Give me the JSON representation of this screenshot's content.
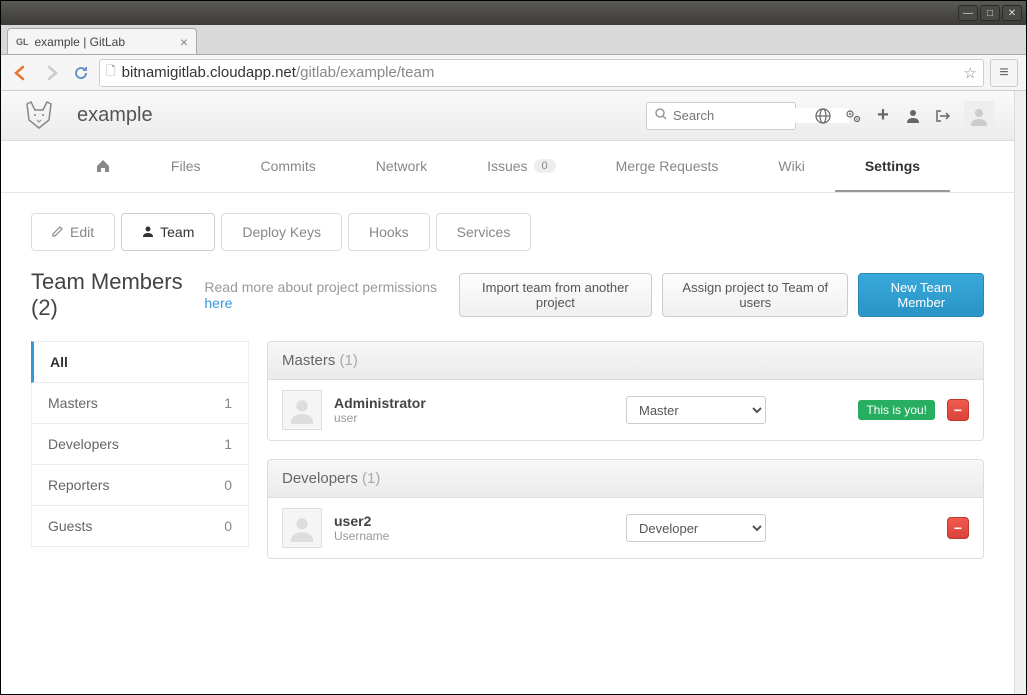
{
  "os": {
    "minimize": "—",
    "maximize": "□",
    "close": "✕"
  },
  "browser": {
    "tab_favicon": "GL",
    "tab_title": "example | GitLab",
    "url_host": "bitnamigitlab.cloudapp.net",
    "url_path": "/gitlab/example/team"
  },
  "header": {
    "project_name": "example",
    "search_placeholder": "Search"
  },
  "main_nav": {
    "home": "",
    "files": "Files",
    "commits": "Commits",
    "network": "Network",
    "issues": "Issues",
    "issues_count": "0",
    "merge_requests": "Merge Requests",
    "wiki": "Wiki",
    "settings": "Settings"
  },
  "sub_tabs": {
    "edit": "Edit",
    "team": "Team",
    "deploy_keys": "Deploy Keys",
    "hooks": "Hooks",
    "services": "Services"
  },
  "title": {
    "text": "Team Members",
    "count": "(2)",
    "perm_text": "Read more about project permissions ",
    "perm_link": "here"
  },
  "buttons": {
    "import": "Import team from another project",
    "assign": "Assign project to Team of users",
    "new_member": "New Team Member"
  },
  "filter": [
    {
      "label": "All",
      "count": ""
    },
    {
      "label": "Masters",
      "count": "1"
    },
    {
      "label": "Developers",
      "count": "1"
    },
    {
      "label": "Reporters",
      "count": "0"
    },
    {
      "label": "Guests",
      "count": "0"
    }
  ],
  "groups": [
    {
      "role": "Masters",
      "count": "(1)",
      "members": [
        {
          "name": "Administrator",
          "username": "user",
          "select": "Master",
          "you": "This is you!"
        }
      ]
    },
    {
      "role": "Developers",
      "count": "(1)",
      "members": [
        {
          "name": "user2",
          "username": "Username",
          "select": "Developer",
          "you": ""
        }
      ]
    }
  ]
}
